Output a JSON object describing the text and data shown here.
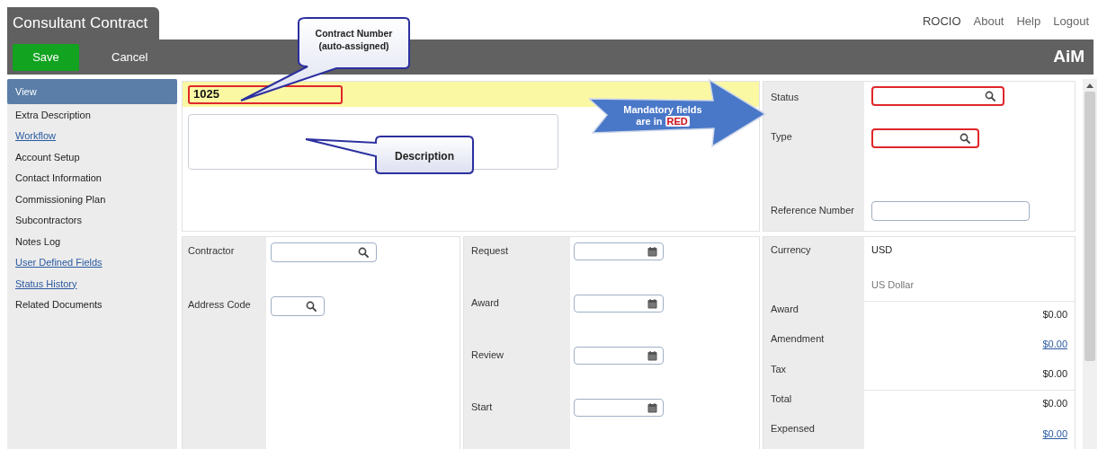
{
  "app_tab": {
    "title": "Consultant Contract"
  },
  "user_menu": [
    {
      "label": "ROCIO",
      "kind": "user"
    },
    {
      "label": "About",
      "kind": "link"
    },
    {
      "label": "Help",
      "kind": "link"
    },
    {
      "label": "Logout",
      "kind": "link"
    }
  ],
  "toolbar": {
    "buttons": [
      {
        "label": "Save",
        "kind": "primary"
      },
      {
        "label": "Cancel",
        "kind": "plain"
      }
    ],
    "brand": "AiM"
  },
  "sidebar": {
    "items": [
      {
        "label": "View",
        "selected": true,
        "kind": "text"
      },
      {
        "label": "Extra Description",
        "selected": false,
        "kind": "text"
      },
      {
        "label": "Workflow",
        "selected": false,
        "kind": "link"
      },
      {
        "label": "Account Setup",
        "selected": false,
        "kind": "text"
      },
      {
        "label": "Contact Information",
        "selected": false,
        "kind": "text"
      },
      {
        "label": "Commissioning Plan",
        "selected": false,
        "kind": "text"
      },
      {
        "label": "Subcontractors",
        "selected": false,
        "kind": "text"
      },
      {
        "label": "Notes Log",
        "selected": false,
        "kind": "text"
      },
      {
        "label": "User Defined Fields",
        "selected": false,
        "kind": "link"
      },
      {
        "label": "Status History",
        "selected": false,
        "kind": "link"
      },
      {
        "label": "Related Documents",
        "selected": false,
        "kind": "text"
      }
    ]
  },
  "header_panel": {
    "contract_number": {
      "value": "1025",
      "required": true
    }
  },
  "status_panel": {
    "fields": [
      {
        "label": "Status",
        "kind": "lookup",
        "required": true
      },
      {
        "label": "Type",
        "kind": "lookup_short",
        "required": true
      },
      {
        "label": "Reference Number",
        "kind": "text",
        "required": false
      }
    ]
  },
  "contractor_panel": {
    "fields": [
      {
        "label": "Contractor",
        "kind": "lookup",
        "required": false
      },
      {
        "label": "Address Code",
        "kind": "lookup_short",
        "required": false
      }
    ]
  },
  "dates_panel": {
    "fields": [
      {
        "label": "Request"
      },
      {
        "label": "Award"
      },
      {
        "label": "Review"
      },
      {
        "label": "Start"
      }
    ]
  },
  "amounts_panel": {
    "currency": {
      "label": "Currency",
      "code": "USD",
      "name": "US Dollar"
    },
    "rows": [
      {
        "label": "Award",
        "value": "$0.00",
        "kind": "text"
      },
      {
        "label": "Amendment",
        "value": "$0.00",
        "kind": "link"
      },
      {
        "label": "Tax",
        "value": "$0.00",
        "kind": "text"
      },
      {
        "label": "Total",
        "value": "$0.00",
        "kind": "text"
      },
      {
        "label": "Expensed",
        "value": "$0.00",
        "kind": "link"
      }
    ]
  },
  "callouts": {
    "contract_number": {
      "lines": [
        "Contract Number",
        "(auto-assigned)"
      ]
    },
    "description": {
      "text": "Description"
    },
    "mandatory": {
      "lines": [
        "Mandatory fields",
        "are in"
      ],
      "highlight": "RED"
    }
  }
}
